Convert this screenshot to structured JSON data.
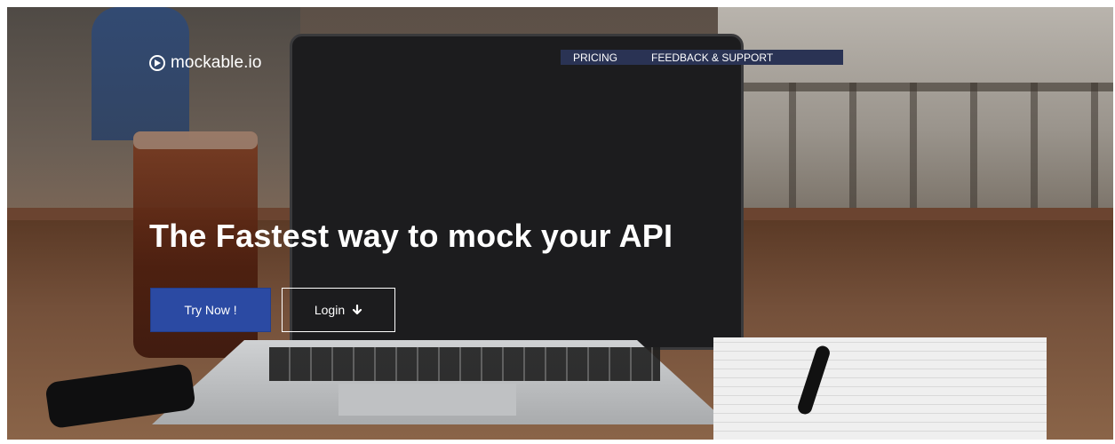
{
  "brand": {
    "name": "mockable.io",
    "icon": "play-circle-icon"
  },
  "nav": {
    "items": [
      {
        "label": "PRICING"
      },
      {
        "label": "FEEDBACK & SUPPORT"
      }
    ]
  },
  "hero": {
    "headline": "The Fastest way to mock your API",
    "primary_button": "Try Now !",
    "secondary_button": "Login",
    "secondary_button_icon": "arrow-down-icon"
  },
  "colors": {
    "nav_bg": "#2a3354",
    "primary_button": "#2b4aa3",
    "text": "#ffffff"
  }
}
